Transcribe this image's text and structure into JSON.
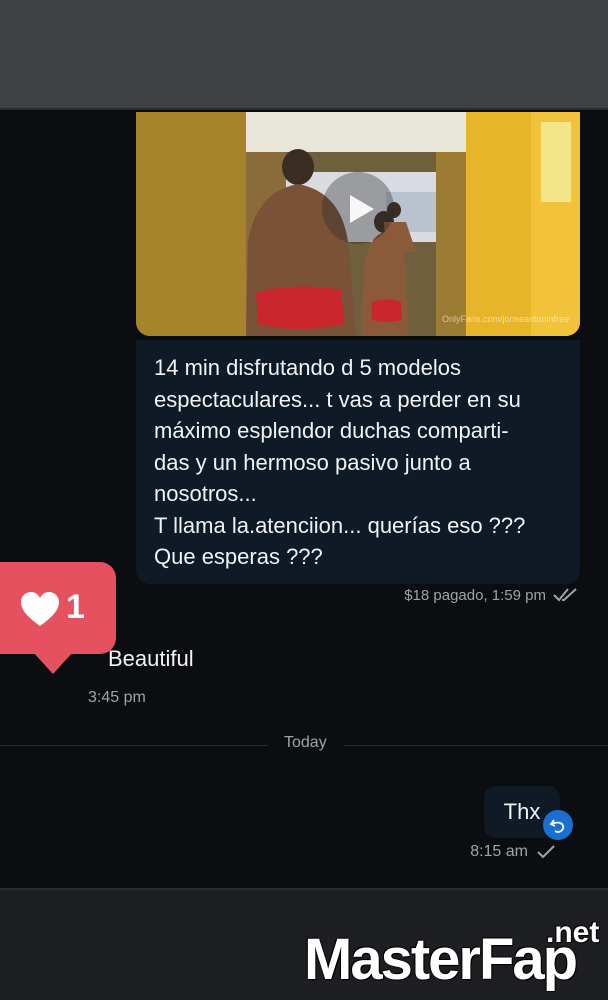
{
  "message_in": {
    "media_watermark": "OnlyFans.com/jonseantoninfree",
    "text": "14 min disfrutando d 5 modelos\nespectaculares... t vas a perder en su\nmáximo esplendor duchas comparti-\ndas y un hermoso pasivo junto a\nnosotros...\nT llama la.atenciion... querías eso ???\nQue esperas ???",
    "meta": "$18 pagado,  1:59 pm"
  },
  "message_out_first": {
    "text": "Beautiful",
    "likes": "1",
    "time": "3:45 pm"
  },
  "divider": {
    "label": "Today"
  },
  "message_out_second": {
    "text": "Thx",
    "time": "8:15 am"
  },
  "watermark": {
    "brand": "MasterFap",
    "tld": ".net"
  },
  "colors": {
    "background": "#0c0d10",
    "bubble_dark": "#101a26",
    "heart_badge": "#e65160",
    "reply_icon": "#1b6fd1"
  },
  "icons": [
    "play-icon",
    "heart-icon",
    "double-check-icon",
    "single-check-icon",
    "reply-undo-icon"
  ]
}
